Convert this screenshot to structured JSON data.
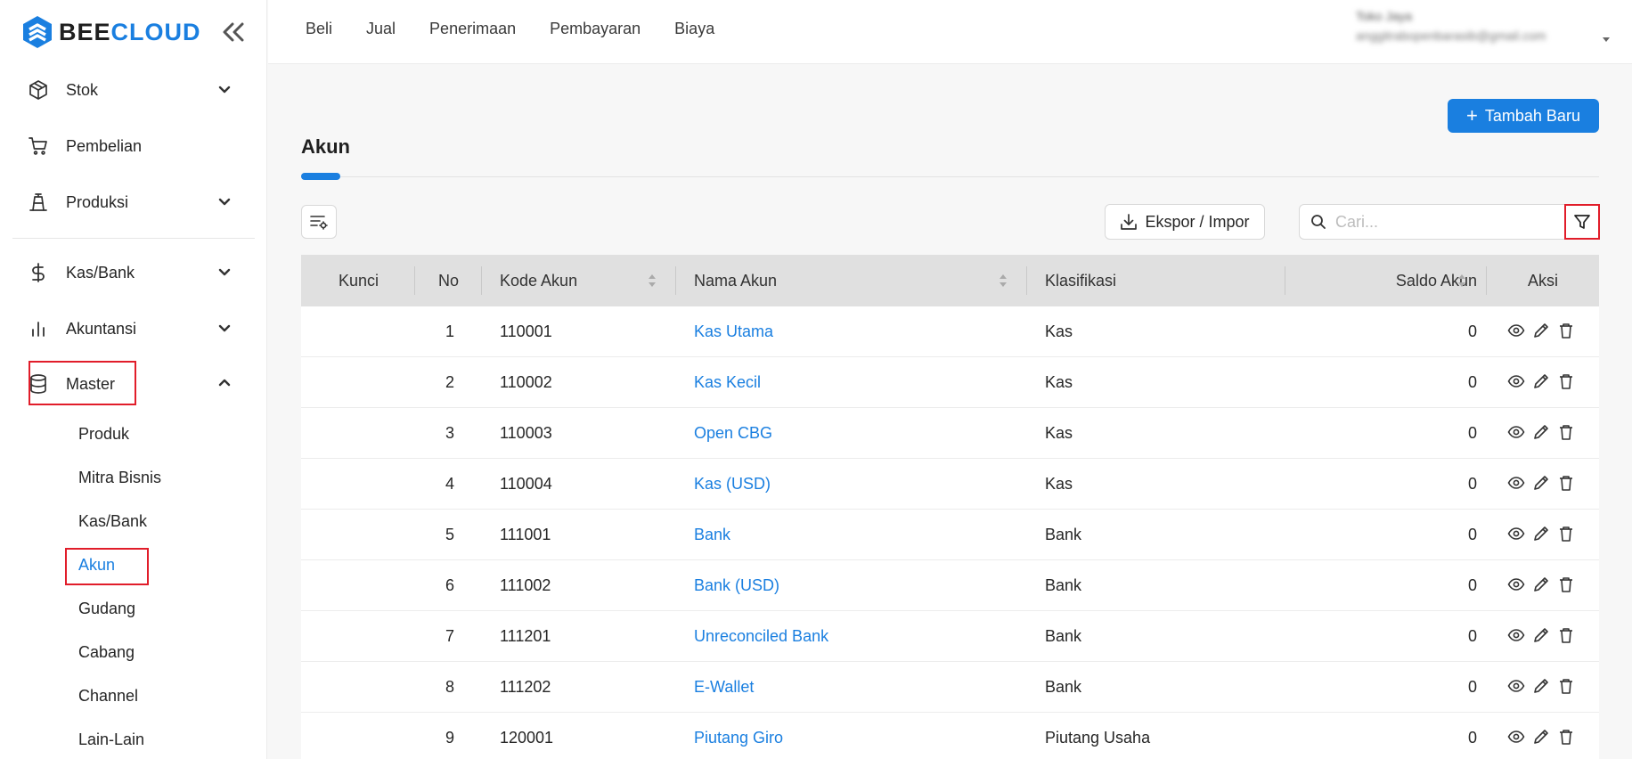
{
  "brand": {
    "name_part1": "BEE",
    "name_part2": "CLOUD",
    "accent": "#1a7fe0"
  },
  "sidebar": {
    "collapse_icon": "double-chevron-left-icon",
    "items": [
      {
        "label": "Stok",
        "icon": "box-icon",
        "expandable": true,
        "expanded": false
      },
      {
        "label": "Pembelian",
        "icon": "cart-icon",
        "expandable": false
      },
      {
        "label": "Produksi",
        "icon": "factory-icon",
        "expandable": true,
        "expanded": false
      },
      {
        "label": "Kas/Bank",
        "icon": "dollar-icon",
        "expandable": true,
        "expanded": false
      },
      {
        "label": "Akuntansi",
        "icon": "bar-chart-icon",
        "expandable": true,
        "expanded": false
      },
      {
        "label": "Master",
        "icon": "database-icon",
        "expandable": true,
        "expanded": true
      }
    ],
    "master_submenu": [
      {
        "label": "Produk",
        "active": false
      },
      {
        "label": "Mitra Bisnis",
        "active": false
      },
      {
        "label": "Kas/Bank",
        "active": false
      },
      {
        "label": "Akun",
        "active": true
      },
      {
        "label": "Gudang",
        "active": false
      },
      {
        "label": "Cabang",
        "active": false
      },
      {
        "label": "Channel",
        "active": false
      },
      {
        "label": "Lain-Lain",
        "active": false
      }
    ]
  },
  "topnav": {
    "items": [
      "Beli",
      "Jual",
      "Penerimaan",
      "Pembayaran",
      "Biaya"
    ]
  },
  "user": {
    "name": "Toko Jaya",
    "email": "anggitrabopenbarasib@gmail.com"
  },
  "main": {
    "add_button": "Tambah Baru",
    "title": "Akun",
    "export_button": "Ekspor / Impor",
    "search_placeholder": "Cari..."
  },
  "table": {
    "columns": [
      "Kunci",
      "No",
      "Kode Akun",
      "Nama Akun",
      "Klasifikasi",
      "Saldo Akun",
      "Aksi"
    ],
    "rows": [
      {
        "kunci": "",
        "no": "1",
        "kode": "110001",
        "nama": "Kas Utama",
        "klasifikasi": "Kas",
        "saldo": "0"
      },
      {
        "kunci": "",
        "no": "2",
        "kode": "110002",
        "nama": "Kas Kecil",
        "klasifikasi": "Kas",
        "saldo": "0"
      },
      {
        "kunci": "",
        "no": "3",
        "kode": "110003",
        "nama": "Open CBG",
        "klasifikasi": "Kas",
        "saldo": "0"
      },
      {
        "kunci": "",
        "no": "4",
        "kode": "110004",
        "nama": "Kas (USD)",
        "klasifikasi": "Kas",
        "saldo": "0"
      },
      {
        "kunci": "",
        "no": "5",
        "kode": "111001",
        "nama": "Bank",
        "klasifikasi": "Bank",
        "saldo": "0"
      },
      {
        "kunci": "",
        "no": "6",
        "kode": "111002",
        "nama": "Bank (USD)",
        "klasifikasi": "Bank",
        "saldo": "0"
      },
      {
        "kunci": "",
        "no": "7",
        "kode": "111201",
        "nama": "Unreconciled Bank",
        "klasifikasi": "Bank",
        "saldo": "0"
      },
      {
        "kunci": "",
        "no": "8",
        "kode": "111202",
        "nama": "E-Wallet",
        "klasifikasi": "Bank",
        "saldo": "0"
      },
      {
        "kunci": "",
        "no": "9",
        "kode": "120001",
        "nama": "Piutang Giro",
        "klasifikasi": "Piutang Usaha",
        "saldo": "0"
      }
    ],
    "row_actions": [
      "eye-icon",
      "pencil-icon",
      "trash-icon"
    ]
  },
  "colors": {
    "highlight": "#e11d2a",
    "header_bg": "#e0e0e0",
    "link": "#1a7fe0"
  }
}
